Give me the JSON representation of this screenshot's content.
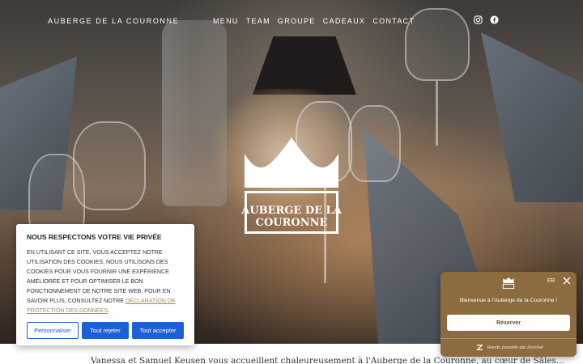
{
  "header": {
    "brand": "AUBERGE DE LA COURONNE",
    "nav": [
      "MENU",
      "TEAM",
      "GROUPE",
      "CADEAUX",
      "CONTACT"
    ],
    "social": [
      "instagram-icon",
      "facebook-icon"
    ]
  },
  "hero": {
    "logo_line1": "AUBERGE DE LA",
    "logo_line2": "COURONNE"
  },
  "cookie": {
    "title": "NOUS RESPECTONS VOTRE VIE PRIVÉE",
    "body": "EN UTILISANT CE SITE, VOUS ACCEPTEZ NOTRE UTILISATION DES COOKIES. NOUS UTILISONS DES COOKIES POUR VOUS FOURNIR UNE EXPÉRIENCE AMÉLIORÉE ET POUR OPTIMISER LE BON FONCTIONNEMENT DE NOTRE SITE WEB. POUR EN SAVOIR PLUS, CONSULTEZ NOTRE ",
    "link": "DÉCLARATION DE PROTECTION DES DONNÉES",
    "period": ".",
    "btn_customize": "Personnaliser",
    "btn_reject": "Tout rejeter",
    "btn_accept": "Tout accepter"
  },
  "widget": {
    "lang": "FR",
    "welcome": "Bienvenue à l'Auberge de la Couronne !",
    "reserve": "Réserver",
    "powered": "Rendu possible par Zenchef"
  },
  "intro": "Vanessa et Samuel Keusen vous accueillent chaleureusement à l'Auberge de la Couronne, au cœur de Sâles..."
}
